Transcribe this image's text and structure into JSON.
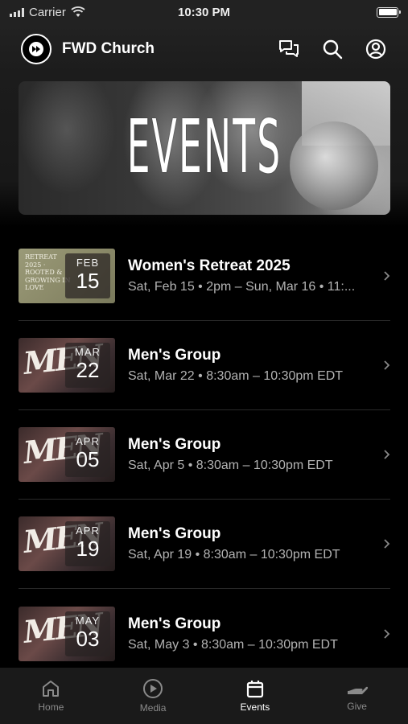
{
  "status_bar": {
    "carrier": "Carrier",
    "time": "10:30 PM"
  },
  "header": {
    "title": "FWD Church",
    "icons": [
      "forward-logo-icon",
      "chat-icon",
      "search-icon",
      "profile-icon"
    ]
  },
  "banner": {
    "title": "EVENTS"
  },
  "events": [
    {
      "thumbnail": "retreat",
      "thumb_text": "RETREAT 2025 · ROOTED & GROWING IN LOVE",
      "month": "FEB",
      "day": "15",
      "title": "Women's Retreat 2025",
      "subtitle": "Sat, Feb 15 • 2pm – Sun, Mar 16 • 11:..."
    },
    {
      "thumbnail": "mens",
      "thumb_text": "MEN",
      "month": "MAR",
      "day": "22",
      "title": "Men's Group",
      "subtitle": "Sat, Mar 22 • 8:30am – 10:30pm EDT"
    },
    {
      "thumbnail": "mens",
      "thumb_text": "MEN",
      "month": "APR",
      "day": "05",
      "title": "Men's Group",
      "subtitle": "Sat, Apr 5 • 8:30am – 10:30pm EDT"
    },
    {
      "thumbnail": "mens",
      "thumb_text": "MEN",
      "month": "APR",
      "day": "19",
      "title": "Men's Group",
      "subtitle": "Sat, Apr 19 • 8:30am – 10:30pm EDT"
    },
    {
      "thumbnail": "mens",
      "thumb_text": "MEN",
      "month": "MAY",
      "day": "03",
      "title": "Men's Group",
      "subtitle": "Sat, May 3 • 8:30am – 10:30pm EDT"
    }
  ],
  "tab_bar": {
    "active": "Events",
    "tabs": [
      {
        "label": "Home",
        "icon": "home-icon"
      },
      {
        "label": "Media",
        "icon": "play-icon"
      },
      {
        "label": "Events",
        "icon": "calendar-icon"
      },
      {
        "label": "Give",
        "icon": "give-icon"
      }
    ]
  },
  "colors": {
    "background": "#000000",
    "header": "#1f1f1f",
    "subtitle": "#b3b3b3",
    "inactive_tab": "#8a8a8a"
  }
}
